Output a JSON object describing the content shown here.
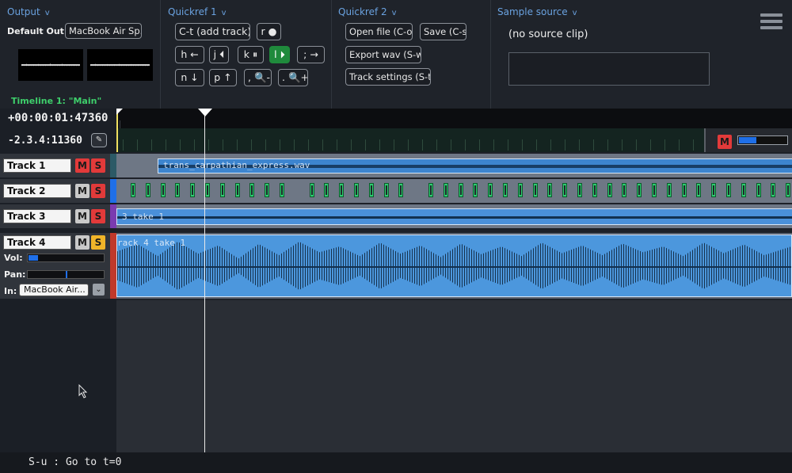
{
  "output": {
    "title": "Output",
    "chevron": "v",
    "default_out_label": "Default Out:",
    "default_out_value": "MacBook Air Sp..."
  },
  "quickref1": {
    "title": "Quickref 1",
    "chevron": "v",
    "keys": {
      "add_track": "C-t (add track)",
      "record": "r ●",
      "h_left": "h ←",
      "j_prev": "j ⏴",
      "k_pause": "k ⏸",
      "l_play": "l ⏵",
      "semicolon_right": "; →",
      "n_down": "n ↓",
      "p_up": "p ↑",
      "zoom_out": ", 🔍-",
      "zoom_in": ". 🔍+"
    }
  },
  "quickref2": {
    "title": "Quickref 2",
    "chevron": "v",
    "keys": {
      "open_file": "Open file (C-o)",
      "save": "Save (C-s)",
      "export_wav": "Export wav (S-w)",
      "track_settings": "Track settings (S-t)"
    }
  },
  "sample_source": {
    "title": "Sample source",
    "chevron": "v",
    "status": "(no source clip)"
  },
  "timeline": {
    "label": "Timeline 1: \"Main\"",
    "time_position": "+00:00:01:47360",
    "bar_beat": "-2.3.4:11360",
    "master_mute": "M",
    "master_level": 0.35
  },
  "tracks": [
    {
      "name": "Track 1",
      "mute": "M",
      "solo": "S",
      "mute_on": true,
      "clip_label": "trans_carpathian_express.wav",
      "color": "#2c5a66"
    },
    {
      "name": "Track 2",
      "mute": "M",
      "solo": "S",
      "mute_on": false,
      "clip_label": "",
      "color": "#1f6fe8"
    },
    {
      "name": "Track 3",
      "mute": "M",
      "solo": "S",
      "mute_on": false,
      "clip_label": "3 take 1",
      "color": "#7a3bb0"
    },
    {
      "name": "Track 4",
      "mute": "M",
      "solo": "S",
      "mute_on": false,
      "clip_label": "rack 4 take 1",
      "color": "#c0392b",
      "vol_label": "Vol:",
      "vol_level": 0.12,
      "pan_label": "Pan:",
      "pan_position": 0.5,
      "in_label": "In:",
      "in_value": "MacBook Air...",
      "in_dd": "⌄"
    }
  ],
  "status_bar": {
    "text": "S-u : Go to t=0"
  },
  "icons": {
    "menu": "hamburger-menu-icon",
    "marker": "marker-icon"
  }
}
